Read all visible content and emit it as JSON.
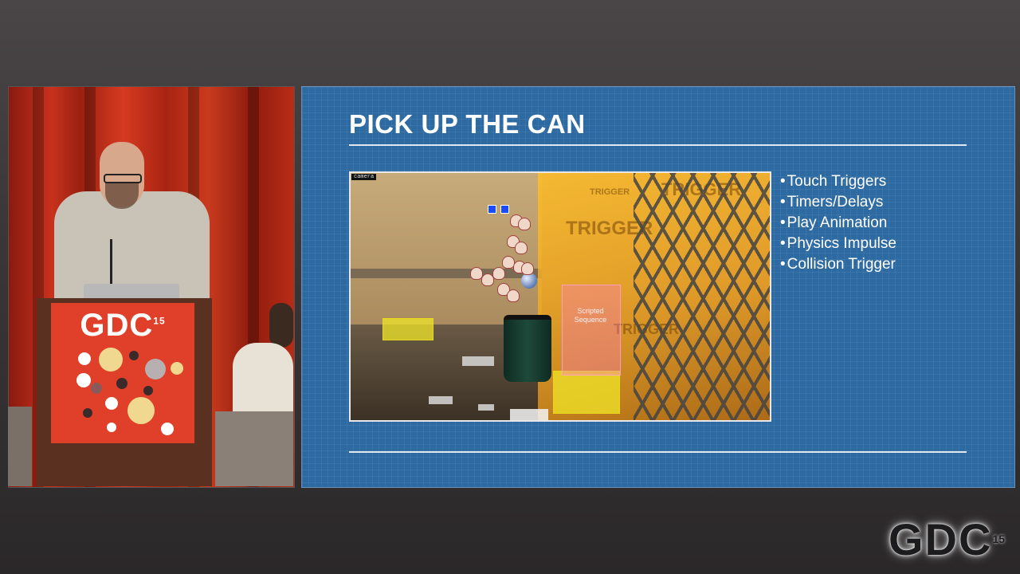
{
  "slide": {
    "title": "PICK UP THE CAN",
    "bullets": [
      "Touch Triggers",
      "Timers/Delays",
      "Play Animation",
      "Physics Impulse",
      "Collision Trigger"
    ],
    "screenshot": {
      "camera_label": "camera",
      "scripted_sequence_label": "Scripted Sequence",
      "trigger_text": "TRIGGER"
    }
  },
  "podium": {
    "logo_text": "GDC",
    "logo_number": "15"
  },
  "corner_logo": {
    "text": "GDC",
    "number": "15"
  },
  "colors": {
    "slide_background": "#2e6aa2",
    "slide_text": "#ffffff",
    "podium_sign": "#e0402a",
    "curtain": "#c8321c"
  }
}
